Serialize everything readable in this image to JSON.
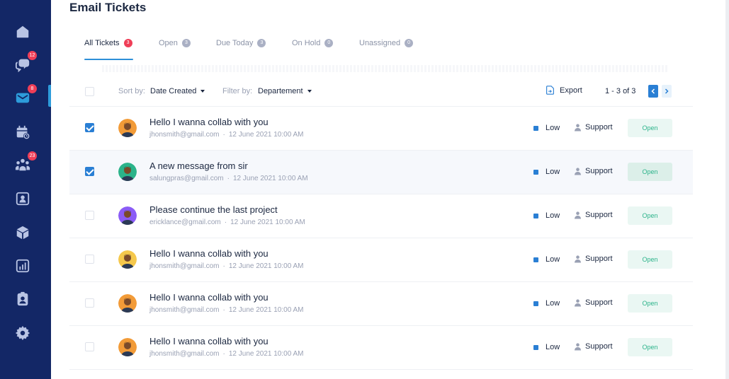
{
  "sidebar": {
    "items": [
      {
        "name": "home",
        "icon": "home-icon",
        "badge": ""
      },
      {
        "name": "chat",
        "icon": "chat-bubbles-icon",
        "badge": "12"
      },
      {
        "name": "email",
        "icon": "mail-icon",
        "badge": "8",
        "active": true
      },
      {
        "name": "calendar",
        "icon": "calendar-icon",
        "badge": ""
      },
      {
        "name": "team",
        "icon": "team-icon",
        "badge": "23"
      },
      {
        "name": "contacts",
        "icon": "contact-card-icon",
        "badge": ""
      },
      {
        "name": "products",
        "icon": "cube-icon",
        "badge": ""
      },
      {
        "name": "reports",
        "icon": "chart-icon",
        "badge": ""
      },
      {
        "name": "agents",
        "icon": "id-badge-icon",
        "badge": ""
      },
      {
        "name": "settings",
        "icon": "gear-icon",
        "badge": ""
      }
    ],
    "colors": {
      "background": "#132766",
      "icon": "#b9c4e4",
      "active_icon": "#2d9cdb",
      "badge": "#ef3e57"
    }
  },
  "page": {
    "title": "Email Tickets"
  },
  "tabs": [
    {
      "label": "All Tickets",
      "count": "3",
      "active": true
    },
    {
      "label": "Open",
      "count": "3"
    },
    {
      "label": "Due Today",
      "count": "3"
    },
    {
      "label": "On Hold",
      "count": "0"
    },
    {
      "label": "Unassigned",
      "count": "0"
    }
  ],
  "toolbar": {
    "sort_label": "Sort by:",
    "sort_value": "Date Created",
    "filter_label": "Filter by:",
    "filter_value": "Departement",
    "export_label": "Export",
    "pagination": "1 - 3 of 3"
  },
  "tickets": [
    {
      "subject": "Hello I wanna collab with you",
      "email": "jhonsmith@gmail.com",
      "date": "12 June 2021 10:00 AM",
      "priority": "Low",
      "team": "Support",
      "status": "Open",
      "checked": true,
      "avatar": "orange"
    },
    {
      "subject": "A new message from sir",
      "email": "salungpras@gmail.com",
      "date": "12 June 2021 10:00 AM",
      "priority": "Low",
      "team": "Support",
      "status": "Open",
      "checked": true,
      "avatar": "green"
    },
    {
      "subject": "Please continue the last project",
      "email": "ericklance@gmail.com",
      "date": "12 June 2021 10:00 AM",
      "priority": "Low",
      "team": "Support",
      "status": "Open",
      "checked": false,
      "avatar": "purple"
    },
    {
      "subject": "Hello I wanna collab with you",
      "email": "jhonsmith@gmail.com",
      "date": "12 June 2021 10:00 AM",
      "priority": "Low",
      "team": "Support",
      "status": "Open",
      "checked": false,
      "avatar": "yellow"
    },
    {
      "subject": "Hello I wanna collab with you",
      "email": "jhonsmith@gmail.com",
      "date": "12 June 2021 10:00 AM",
      "priority": "Low",
      "team": "Support",
      "status": "Open",
      "checked": false,
      "avatar": "orange"
    },
    {
      "subject": "Hello I wanna collab with you",
      "email": "jhonsmith@gmail.com",
      "date": "12 June 2021 10:00 AM",
      "priority": "Low",
      "team": "Support",
      "status": "Open",
      "checked": false,
      "avatar": "orange"
    }
  ],
  "colors": {
    "accent": "#2a7fd4",
    "status_open_bg": "#eaf7f3",
    "status_open_text": "#2bb38a",
    "title": "#1c2841"
  }
}
